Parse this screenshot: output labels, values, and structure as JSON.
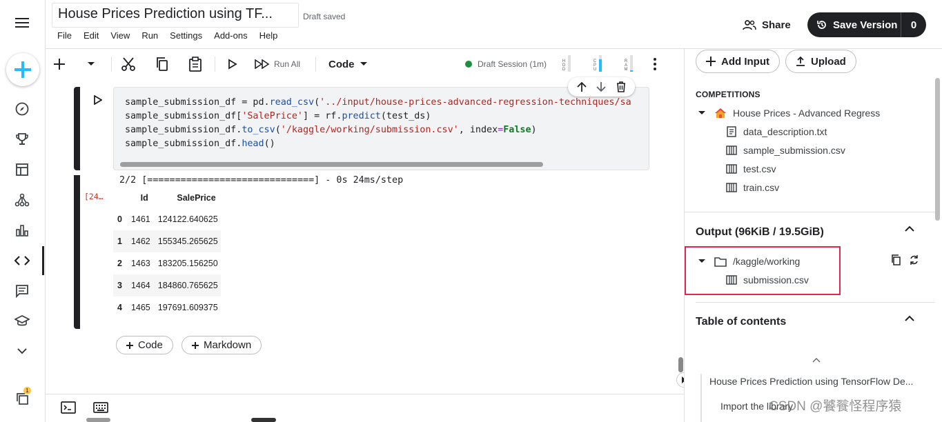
{
  "notebook": {
    "title": "House Prices Prediction using TF...",
    "save_status": "Draft saved",
    "menu": [
      "File",
      "Edit",
      "View",
      "Run",
      "Settings",
      "Add-ons",
      "Help"
    ]
  },
  "header": {
    "share_label": "Share",
    "save_version_label": "Save Version",
    "save_version_count": "0"
  },
  "rail": {
    "notification_badge": "1"
  },
  "toolbar": {
    "run_all_label": "Run All",
    "cell_type": "Code",
    "session_label": "Draft Session (1m)",
    "meters": [
      {
        "label": "HDD",
        "level": 0.0
      },
      {
        "label": "CPU",
        "level": 0.75
      },
      {
        "label": "RAM",
        "level": 0.1
      }
    ]
  },
  "cell": {
    "code_lines": [
      "sample_submission_df = pd.read_csv('../input/house-prices-advanced-regression-techniques/sa",
      "sample_submission_df['SalePrice'] = rf.predict(test_ds)",
      "sample_submission_df.to_csv('/kaggle/working/submission.csv', index=False)",
      "sample_submission_df.head()"
    ],
    "execution_count": "[24…",
    "progress": "2/2 [==============================] - 0s 24ms/step",
    "table": {
      "columns": [
        "",
        "Id",
        "SalePrice"
      ],
      "rows": [
        [
          "0",
          "1461",
          "124122.640625"
        ],
        [
          "1",
          "1462",
          "155345.265625"
        ],
        [
          "2",
          "1463",
          "183205.156250"
        ],
        [
          "3",
          "1464",
          "184860.765625"
        ],
        [
          "4",
          "1465",
          "197691.609375"
        ]
      ]
    }
  },
  "add_cell": {
    "code_label": "Code",
    "markdown_label": "Markdown"
  },
  "panel": {
    "add_input_label": "Add Input",
    "upload_label": "Upload",
    "competitions_heading": "COMPETITIONS",
    "competition_name": "House Prices - Advanced Regress",
    "files": [
      "data_description.txt",
      "sample_submission.csv",
      "test.csv",
      "train.csv"
    ],
    "output_title": "Output (96KiB / 19.5GiB)",
    "output_folder": "/kaggle/working",
    "output_file": "submission.csv",
    "toc_title": "Table of contents",
    "toc_items": [
      "House Prices Prediction using TensorFlow De...",
      "Import the library"
    ],
    "watermark": "CSDN @饕餮怪程序猿"
  },
  "colors": {
    "accent_blue": "#20beff",
    "highlight_red": "#e0284a",
    "session_green": "#1e8e3e",
    "dark": "#202124"
  }
}
